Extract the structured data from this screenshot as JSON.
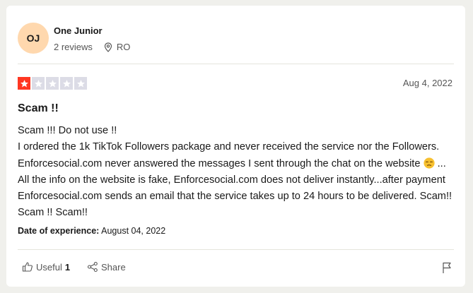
{
  "reviewer": {
    "initials": "OJ",
    "name": "One Junior",
    "review_count": "2 reviews",
    "country": "RO"
  },
  "rating": {
    "stars": 1,
    "max": 5,
    "accent_color": "#ff3722",
    "empty_color": "#dcdce6"
  },
  "review": {
    "date": "Aug 4, 2022",
    "title": "Scam !!",
    "body_line_1": "Scam !!! Do not use !!",
    "body_before_emoji": "I ordered the 1k TikTok Followers package and never received the service nor the Followers. Enforcesocial.com never answered the messages I sent through the chat on the website",
    "body_after_emoji": "... All the info on the website is fake, Enforcesocial.com does not deliver instantly...after payment Enforcesocial.com sends an email that the service takes up to 24 hours to be delivered. Scam!! Scam !! Scam!!",
    "emoji": "unamused-face-icon",
    "experience_label": "Date of experience:",
    "experience_date": "August 04, 2022"
  },
  "footer": {
    "useful_label": "Useful",
    "useful_count": "1",
    "share_label": "Share",
    "icons": [
      "thumbs-up-icon",
      "share-icon",
      "flag-icon"
    ]
  }
}
